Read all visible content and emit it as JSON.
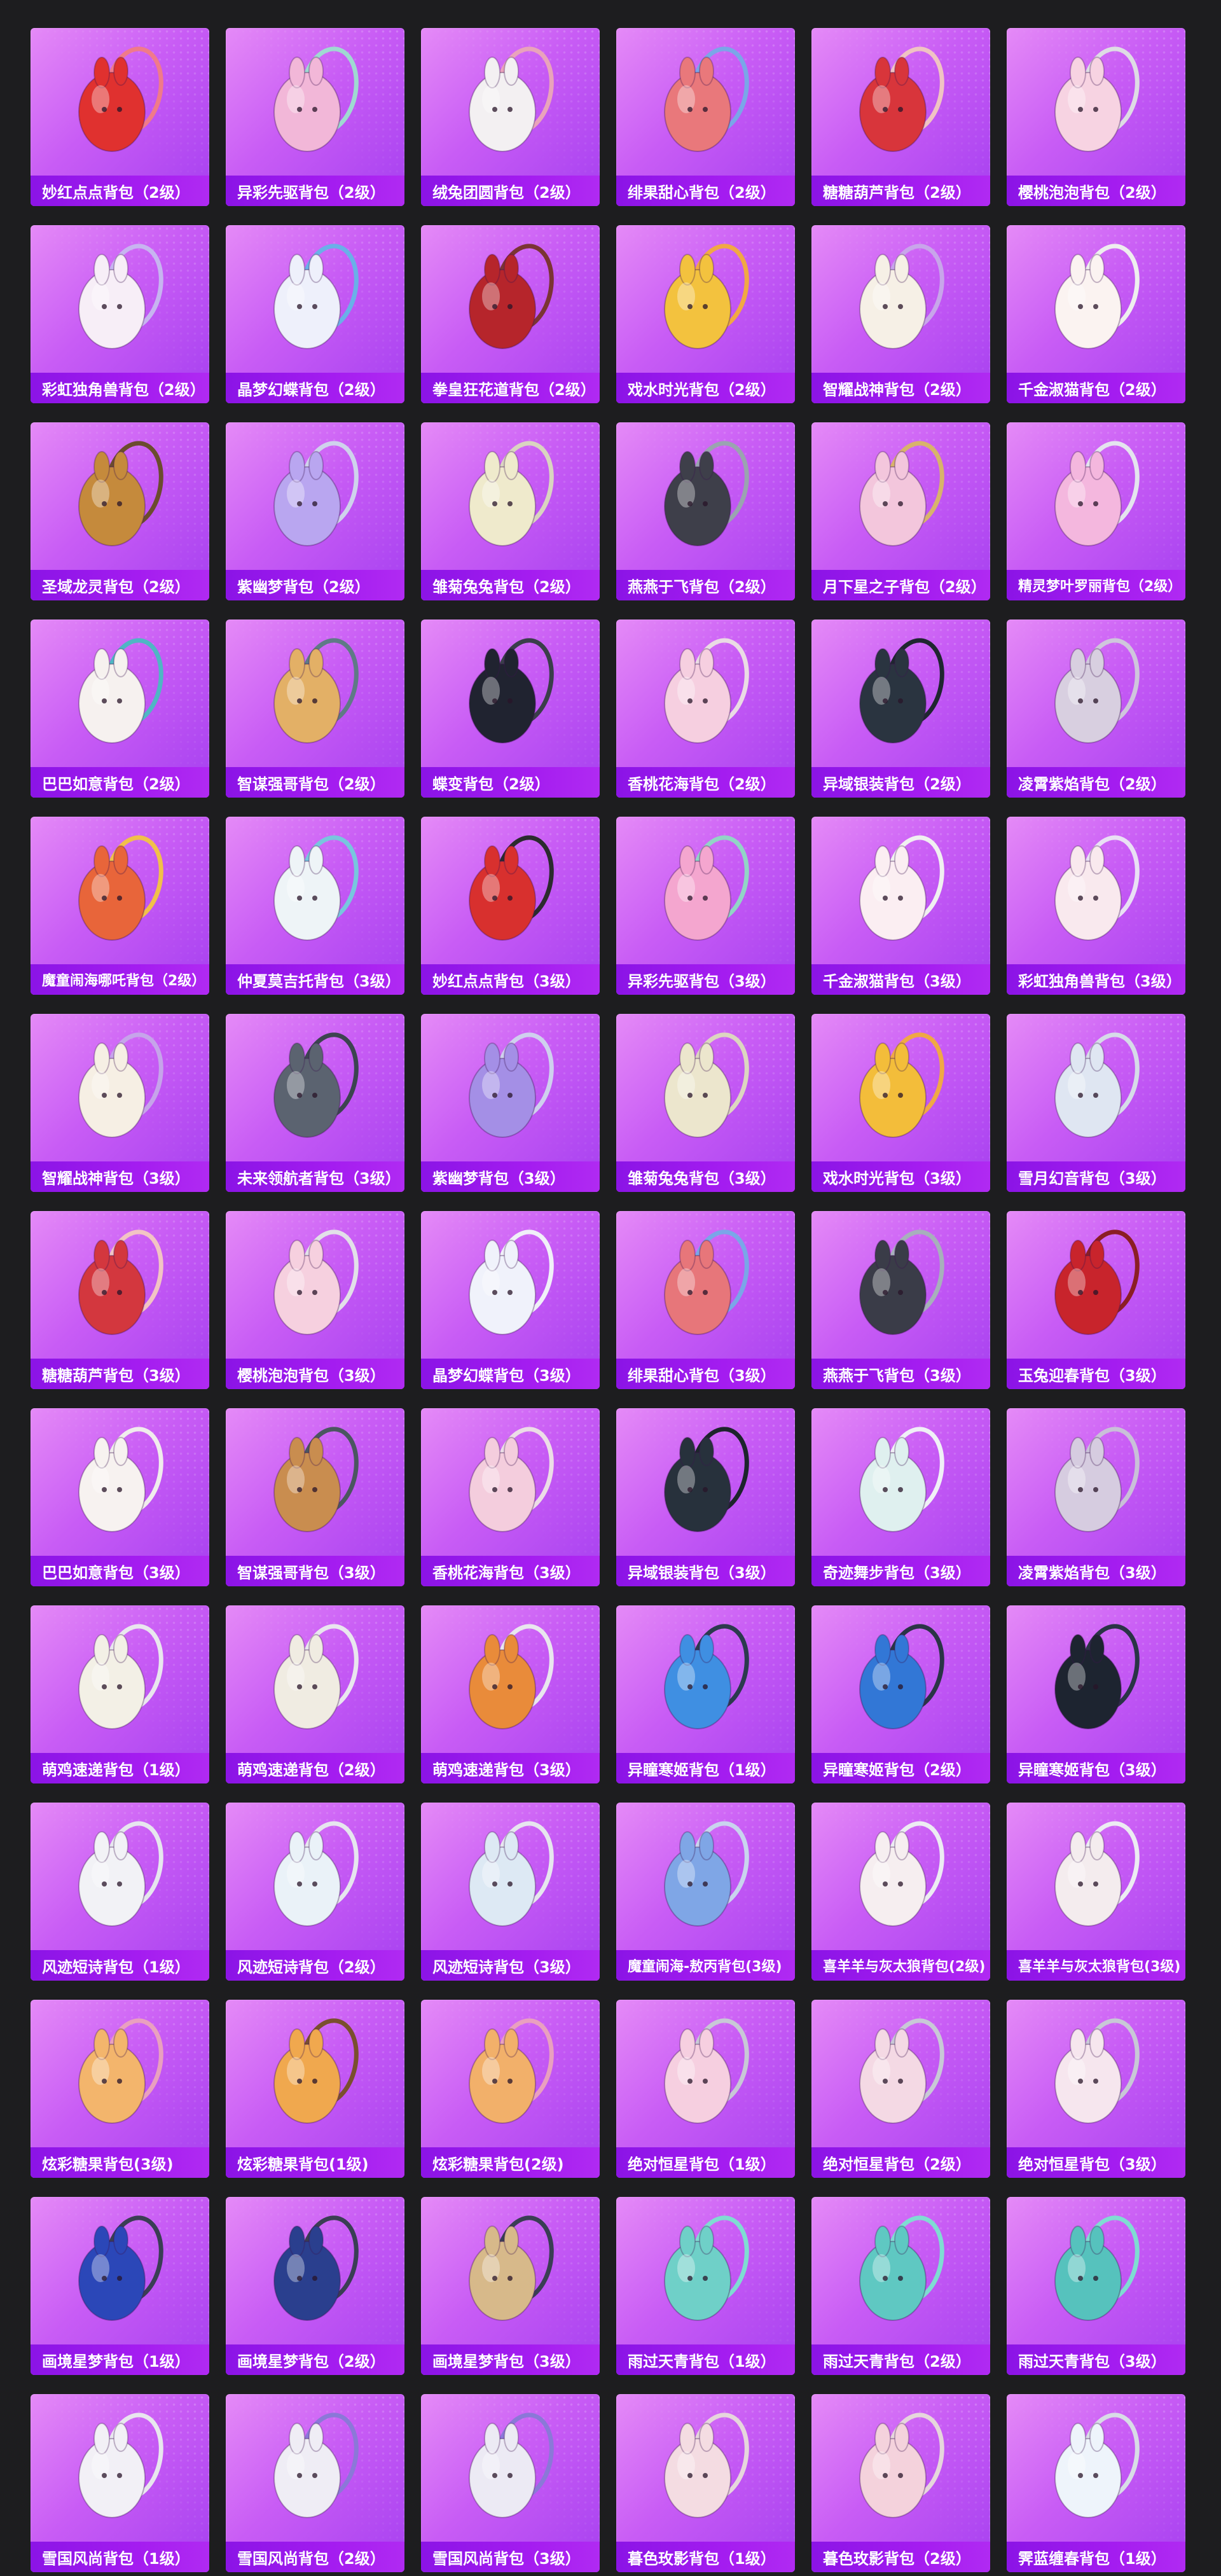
{
  "colors": {
    "page_background": "#1d1d1f",
    "card_gradient_start": "#e58af7",
    "card_gradient_end": "#a640f0",
    "label_bar": "#8b14e6",
    "label_text": "#ffffff"
  },
  "items": [
    {
      "name": "妙红点点背包（2级）",
      "color": "#e0312f",
      "strap": "#f07a8a"
    },
    {
      "name": "异彩先驱背包（2级）",
      "color": "#f2b7d8",
      "strap": "#9fd9d1"
    },
    {
      "name": "绒兔团圆背包（2级）",
      "color": "#f3f0f2",
      "strap": "#e9a3bb"
    },
    {
      "name": "绯果甜心背包（2级）",
      "color": "#e9787b",
      "strap": "#7aa6e8"
    },
    {
      "name": "糖糖葫芦背包（2级）",
      "color": "#d8353b",
      "strap": "#f0c3c3"
    },
    {
      "name": "樱桃泡泡背包（2级）",
      "color": "#f7d3e2",
      "strap": "#dedce4"
    },
    {
      "name": "彩虹独角兽背包（2级）",
      "color": "#f7eef7",
      "strap": "#c7b4f0"
    },
    {
      "name": "晶梦幻蝶背包（2级）",
      "color": "#eef0fb",
      "strap": "#6ab0e8"
    },
    {
      "name": "拳皇狂花道背包（2级）",
      "color": "#b6252b",
      "strap": "#7b3434"
    },
    {
      "name": "戏水时光背包（2级）",
      "color": "#f3c23e",
      "strap": "#f1a844"
    },
    {
      "name": "智耀战神背包（2级）",
      "color": "#f6f0e6",
      "strap": "#c8a5ea"
    },
    {
      "name": "千金淑猫背包（2级）",
      "color": "#fbf3f1",
      "strap": "#eeeeee"
    },
    {
      "name": "圣域龙灵背包（2级）",
      "color": "#c58a3c",
      "strap": "#6b4c2e"
    },
    {
      "name": "紫幽梦背包（2级）",
      "color": "#b9a6f0",
      "strap": "#cfd2ec"
    },
    {
      "name": "雏菊兔兔背包（2级）",
      "color": "#efeacc",
      "strap": "#d9d4c0"
    },
    {
      "name": "燕燕于飞背包（2级）",
      "color": "#3e3f4a",
      "strap": "#9aa4b0"
    },
    {
      "name": "月下星之子背包（2级）",
      "color": "#f3c6dc",
      "strap": "#d8b36b"
    },
    {
      "name": "精灵梦叶罗丽背包（2级）",
      "color": "#f4b7de",
      "strap": "#e4e4ee"
    },
    {
      "name": "巴巴如意背包（2级）",
      "color": "#f6f1ef",
      "strap": "#4fb6c4"
    },
    {
      "name": "智谋强哥背包（2级）",
      "color": "#e3b066",
      "strap": "#5f7a86"
    },
    {
      "name": "蝶变背包（2级）",
      "color": "#202330",
      "strap": "#3a3e4a"
    },
    {
      "name": "香桃花海背包（2级）",
      "color": "#f6cfe0",
      "strap": "#eadbe4"
    },
    {
      "name": "异域银装背包（2级）",
      "color": "#2a3440",
      "strap": "#1f2630"
    },
    {
      "name": "凌霄紫焰背包（2级）",
      "color": "#d8cfe0",
      "strap": "#cfc6dc"
    },
    {
      "name": "魔童闹海哪吒背包（2级）",
      "color": "#e8653a",
      "strap": "#f1c04a"
    },
    {
      "name": "仲夏莫吉托背包（3级）",
      "color": "#eef4f7",
      "strap": "#78c6de"
    },
    {
      "name": "妙红点点背包（3级）",
      "color": "#d8302e",
      "strap": "#2b2b2e"
    },
    {
      "name": "异彩先驱背包（3级）",
      "color": "#f4a6cf",
      "strap": "#92d4c6"
    },
    {
      "name": "千金淑猫背包（3级）",
      "color": "#fbeef2",
      "strap": "#f0f0f0"
    },
    {
      "name": "彩虹独角兽背包（3级）",
      "color": "#f9e9ee",
      "strap": "#e9e0f4"
    },
    {
      "name": "智耀战神背包（3级）",
      "color": "#f6efe4",
      "strap": "#c6a4ea"
    },
    {
      "name": "未来领航者背包（3级）",
      "color": "#5b6370",
      "strap": "#3c4450"
    },
    {
      "name": "紫幽梦背包（3级）",
      "color": "#a48fe6",
      "strap": "#cfd0ee"
    },
    {
      "name": "雏菊兔兔背包（3级）",
      "color": "#ece6cd",
      "strap": "#dcd6c0"
    },
    {
      "name": "戏水时光背包（3级）",
      "color": "#f3bd3a",
      "strap": "#f0a845"
    },
    {
      "name": "雪月幻音背包（3级）",
      "color": "#dfe6f2",
      "strap": "#d6dbe8"
    },
    {
      "name": "糖糖葫芦背包（3级）",
      "color": "#d3373e",
      "strap": "#f2c4c4"
    },
    {
      "name": "樱桃泡泡背包（3级）",
      "color": "#f6d0df",
      "strap": "#e2e0e8"
    },
    {
      "name": "晶梦幻蝶背包（3级）",
      "color": "#f0f2fb",
      "strap": "#f0f0f8"
    },
    {
      "name": "绯果甜心背包（3级）",
      "color": "#e7767a",
      "strap": "#7aa6e8"
    },
    {
      "name": "燕燕于飞背包（3级）",
      "color": "#3a3c48",
      "strap": "#a7b0bb"
    },
    {
      "name": "玉兔迎春背包（3级）",
      "color": "#c8242c",
      "strap": "#8b1e24"
    },
    {
      "name": "巴巴如意背包（3级）",
      "color": "#f7f2f0",
      "strap": "#f0ecec"
    },
    {
      "name": "智谋强哥背包（3级）",
      "color": "#c98d4f",
      "strap": "#4b5660"
    },
    {
      "name": "香桃花海背包（3级）",
      "color": "#f4cddd",
      "strap": "#ecdde6"
    },
    {
      "name": "异域银装背包（3级）",
      "color": "#27313c",
      "strap": "#1d242c"
    },
    {
      "name": "奇迹舞步背包（3级）",
      "color": "#dff0ef",
      "strap": "#f0f0f6"
    },
    {
      "name": "凌霄紫焰背包（3级）",
      "color": "#d6cce0",
      "strap": "#c9c0d8"
    },
    {
      "name": "萌鸡速递背包（1级）",
      "color": "#f3f0e6",
      "strap": "#e9e6ee"
    },
    {
      "name": "萌鸡速递背包（2级）",
      "color": "#f0ece2",
      "strap": "#e9e6ee"
    },
    {
      "name": "萌鸡速递背包（3级）",
      "color": "#e98b3a",
      "strap": "#e9e6ee"
    },
    {
      "name": "异瞳寒姬背包（1级）",
      "color": "#3f8fe2",
      "strap": "#2c3a4e"
    },
    {
      "name": "异瞳寒姬背包（2级）",
      "color": "#3277d6",
      "strap": "#2a3446"
    },
    {
      "name": "异瞳寒姬背包（3级）",
      "color": "#1d2430",
      "strap": "#2a3446"
    },
    {
      "name": "风迹短诗背包（1级）",
      "color": "#f2f2f6",
      "strap": "#e6e6ee"
    },
    {
      "name": "风迹短诗背包（2级）",
      "color": "#eaf2f8",
      "strap": "#e6e6ee"
    },
    {
      "name": "风迹短诗背包（3级）",
      "color": "#dde9f4",
      "strap": "#e6e6ee"
    },
    {
      "name": "魔童闹海-敖丙背包(3级)",
      "color": "#7fa6e6",
      "strap": "#c9d4ee"
    },
    {
      "name": "喜羊羊与灰太狼背包(2级)",
      "color": "#f6eef0",
      "strap": "#ececf2"
    },
    {
      "name": "喜羊羊与灰太狼背包(3级)",
      "color": "#f4ecee",
      "strap": "#ececf2"
    },
    {
      "name": "炫彩糖果背包(3级)",
      "color": "#f3b56c",
      "strap": "#e9a0bf"
    },
    {
      "name": "炫彩糖果背包(1级)",
      "color": "#f0a84e",
      "strap": "#7a4f2e"
    },
    {
      "name": "炫彩糖果背包(2级)",
      "color": "#f2b06a",
      "strap": "#e9a0bf"
    },
    {
      "name": "绝对恒星背包（1级）",
      "color": "#f6cfe0",
      "strap": "#c8c8d6"
    },
    {
      "name": "绝对恒星背包（2级）",
      "color": "#f4d9e4",
      "strap": "#c8c8d6"
    },
    {
      "name": "绝对恒星背包（3级）",
      "color": "#f6e6ee",
      "strap": "#c8c8d6"
    },
    {
      "name": "画境星梦背包（1级）",
      "color": "#2b47b8",
      "strap": "#3a3e54"
    },
    {
      "name": "画境星梦背包（2级）",
      "color": "#2a3f8e",
      "strap": "#3a3e54"
    },
    {
      "name": "画境星梦背包（3级）",
      "color": "#d7b98a",
      "strap": "#3a3e54"
    },
    {
      "name": "雨过天青背包（1级）",
      "color": "#6fd0c8",
      "strap": "#7fdcd2"
    },
    {
      "name": "雨过天青背包（2级）",
      "color": "#5fc8c2",
      "strap": "#7fdcd2"
    },
    {
      "name": "雨过天青背包（3级）",
      "color": "#56c2bd",
      "strap": "#7fdcd2"
    },
    {
      "name": "雪国风尚背包（1级）",
      "color": "#f2f0f6",
      "strap": "#e8e6ee"
    },
    {
      "name": "雪国风尚背包（2级）",
      "color": "#efedf5",
      "strap": "#8b78d8"
    },
    {
      "name": "雪国风尚背包（3级）",
      "color": "#eceaf4",
      "strap": "#8b78d8"
    },
    {
      "name": "暮色玫影背包（1级）",
      "color": "#f4dce2",
      "strap": "#e6d6dc"
    },
    {
      "name": "暮色玫影背包（2级）",
      "color": "#f4d2dc",
      "strap": "#e6d6dc"
    },
    {
      "name": "霁蓝缠春背包（1级）",
      "color": "#eef4fb",
      "strap": "#d8dce6"
    }
  ]
}
